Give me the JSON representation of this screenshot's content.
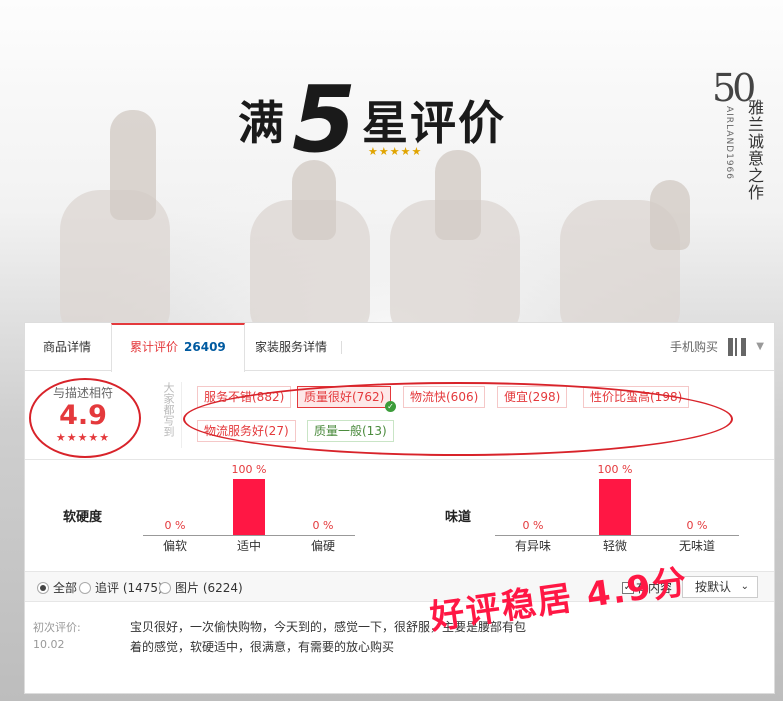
{
  "hero": {
    "title_left": "满",
    "title_number": "5",
    "title_right": "星评价",
    "stars": "★★★★★",
    "brand_number": "50",
    "brand_cn": "雅兰诚意之作",
    "brand_en": "AIRLAND1966"
  },
  "tabs": {
    "product_detail": "商品详情",
    "reviews_label": "累计评价",
    "reviews_count": "26409",
    "service_detail": "家装服务详情",
    "mobile_buy": "手机购买"
  },
  "rating": {
    "label": "与描述相符",
    "score": "4.9",
    "stars": "★★★★★",
    "everyone_says": "大家都写到"
  },
  "tags": [
    {
      "label": "服务不错(882)",
      "selected": false,
      "negative": false
    },
    {
      "label": "质量很好(762)",
      "selected": true,
      "negative": false
    },
    {
      "label": "物流快(606)",
      "selected": false,
      "negative": false
    },
    {
      "label": "便宜(298)",
      "selected": false,
      "negative": false
    },
    {
      "label": "性价比蛮高(198)",
      "selected": false,
      "negative": false
    },
    {
      "label": "物流服务好(27)",
      "selected": false,
      "negative": false
    },
    {
      "label": "质量一般(13)",
      "selected": false,
      "negative": true
    }
  ],
  "attributes": [
    {
      "title": "软硬度",
      "options": [
        {
          "label": "偏软",
          "pct": "0 %",
          "value": 0
        },
        {
          "label": "适中",
          "pct": "100 %",
          "value": 100
        },
        {
          "label": "偏硬",
          "pct": "0 %",
          "value": 0
        }
      ]
    },
    {
      "title": "味道",
      "options": [
        {
          "label": "有异味",
          "pct": "0 %",
          "value": 0
        },
        {
          "label": "轻微",
          "pct": "100 %",
          "value": 100
        },
        {
          "label": "无味道",
          "pct": "0 %",
          "value": 0
        }
      ]
    }
  ],
  "filters": {
    "all": "全部",
    "append": "追评 (1475)",
    "images": "图片 (6224)",
    "has_content": "有内容",
    "sort": "按默认"
  },
  "review": {
    "label": "初次评价:",
    "date": "10.02",
    "text": "宝贝很好，一次偷快购物，今天到的，感觉一下，很舒服，主要是腰部有包着的感觉，软硬适中，很满意，有需要的放心购买"
  },
  "overlay": {
    "stamp": "好评稳居 4.9分"
  },
  "colors": {
    "accent": "#e4393c",
    "bar": "#ff1744",
    "link": "#005aa0"
  }
}
